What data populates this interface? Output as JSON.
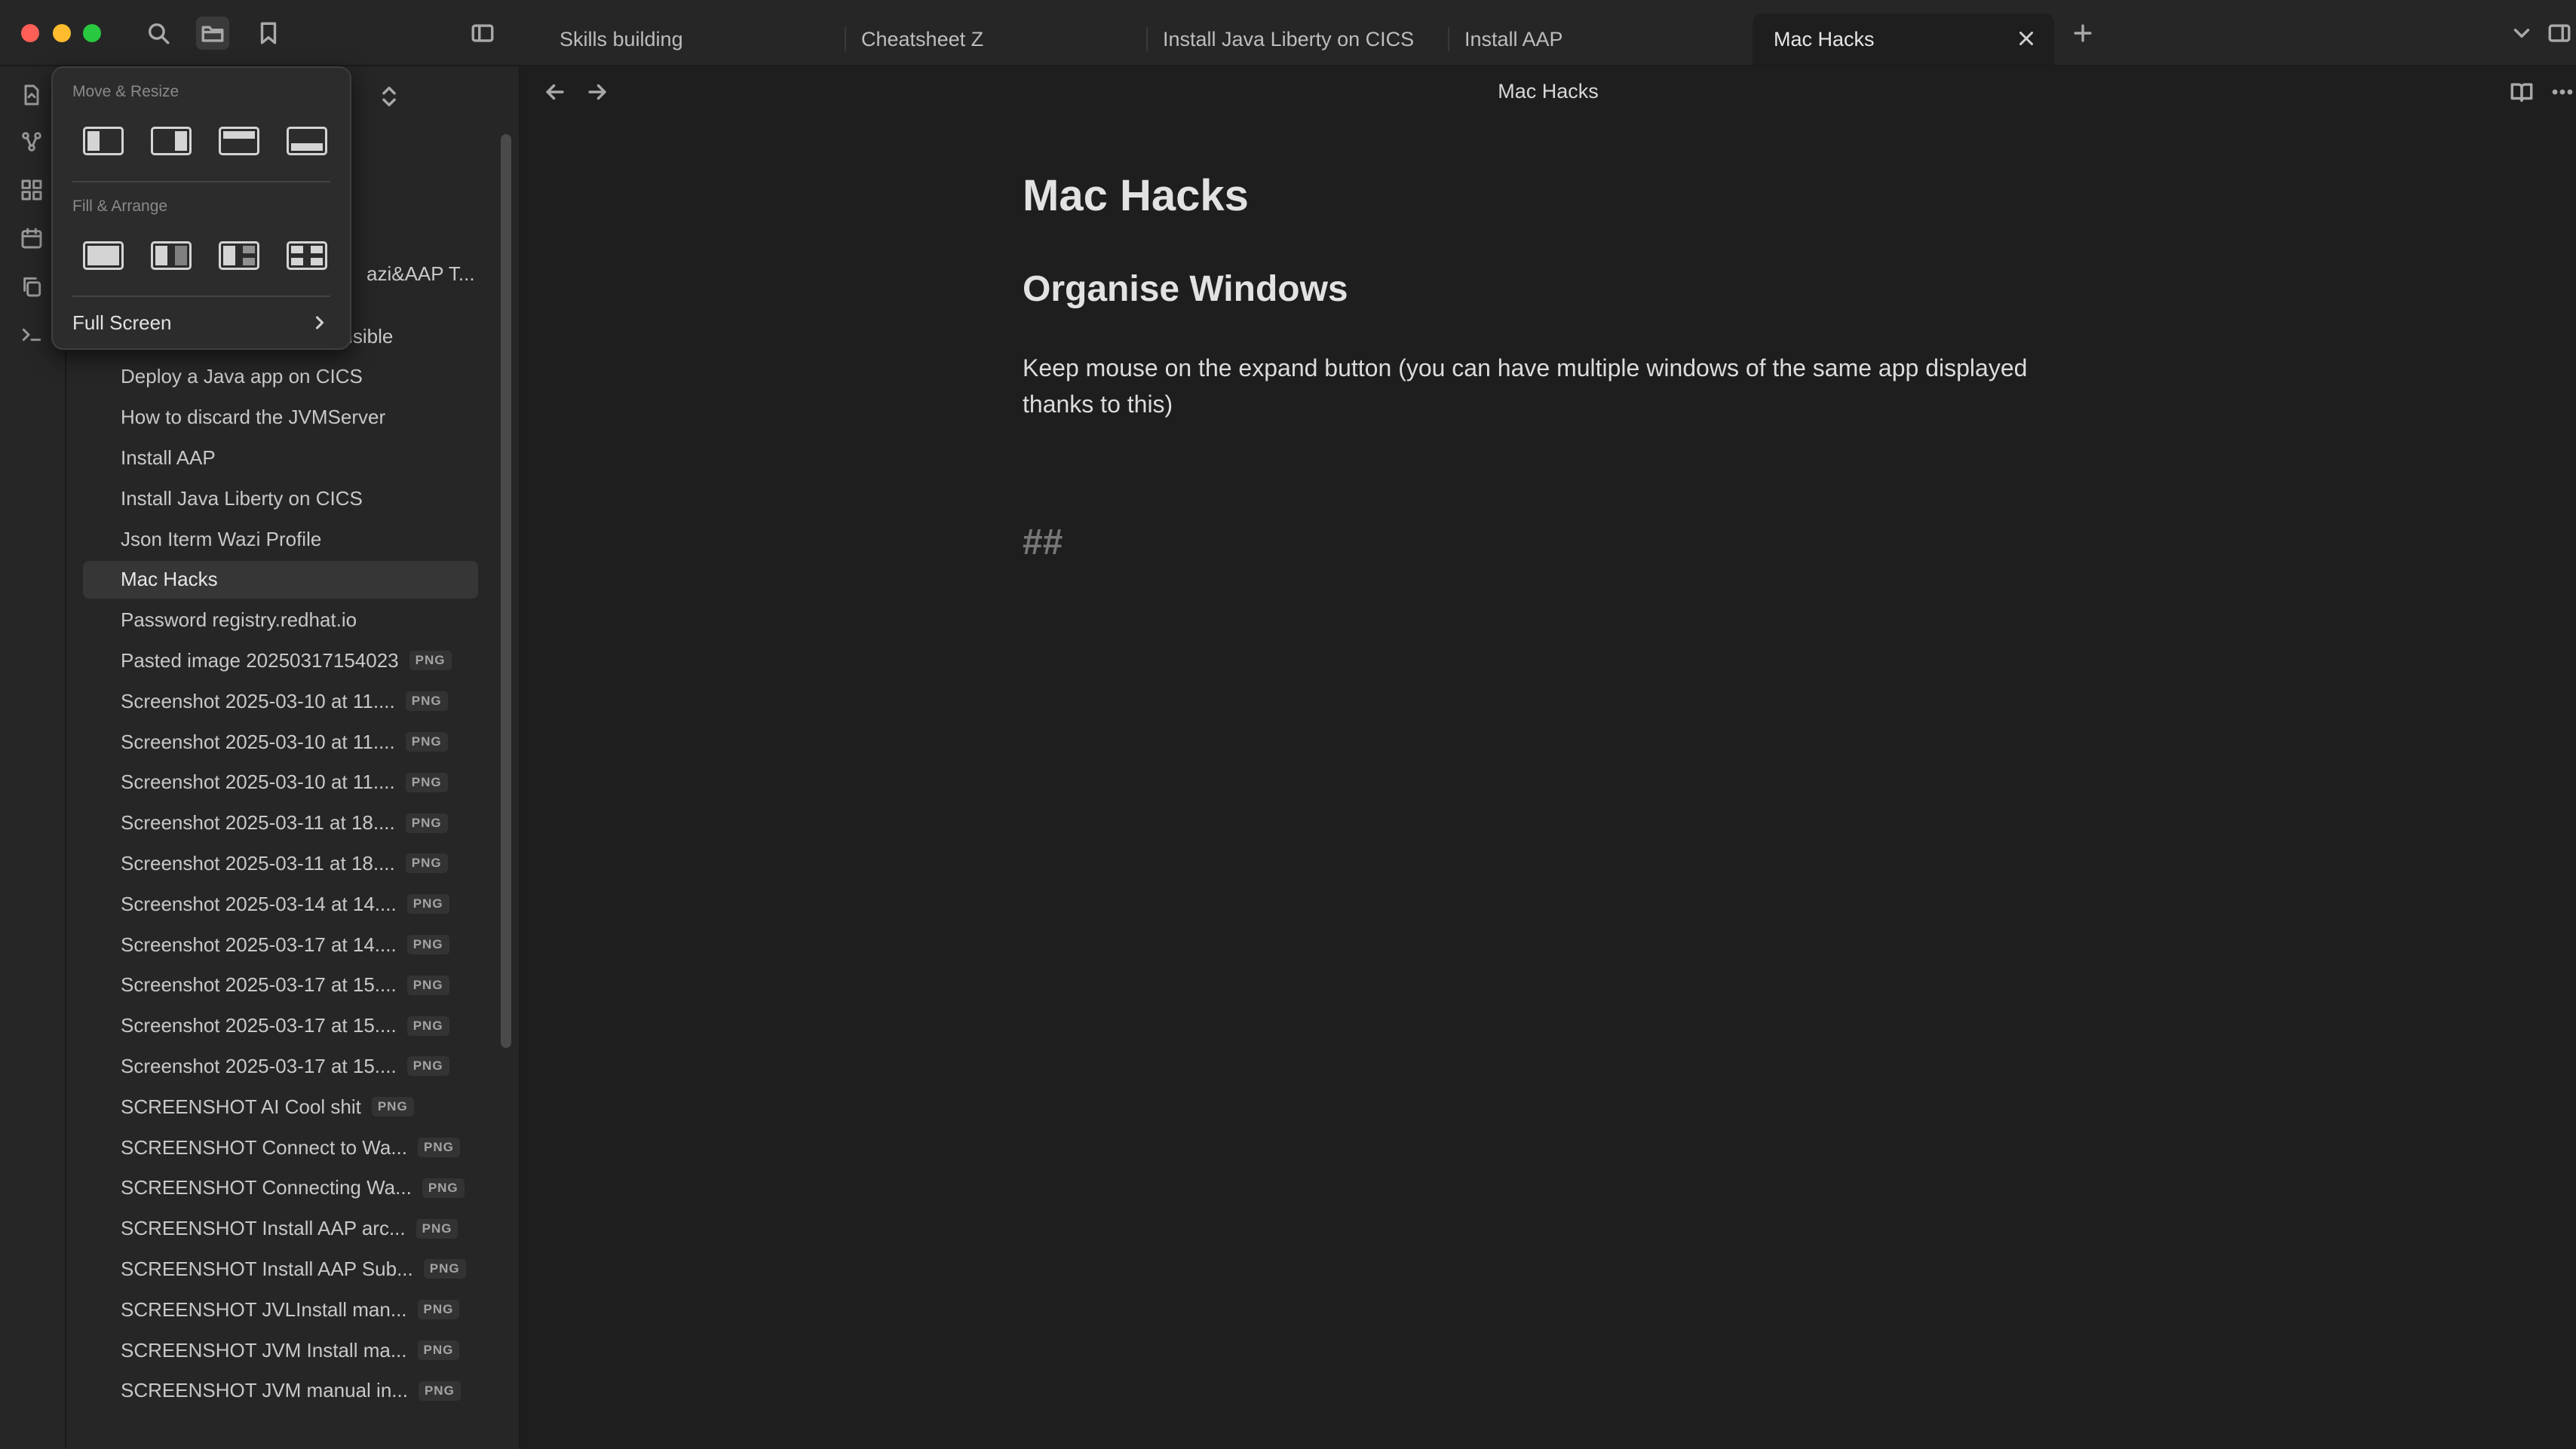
{
  "tabs": [
    {
      "label": "Skills building"
    },
    {
      "label": "Cheatsheet Z"
    },
    {
      "label": "Install Java Liberty on CICS"
    },
    {
      "label": "Install AAP"
    },
    {
      "label": "Mac Hacks"
    }
  ],
  "popup": {
    "move_resize_title": "Move & Resize",
    "fill_arrange_title": "Fill & Arrange",
    "full_screen_label": "Full Screen"
  },
  "sidebar": {
    "partial_item": "azi&AAP T...",
    "files": [
      {
        "name": "Debugging the job from Ansible",
        "badge": ""
      },
      {
        "name": "Deploy a Java app on CICS",
        "badge": ""
      },
      {
        "name": "How to discard the JVMServer",
        "badge": ""
      },
      {
        "name": "Install AAP",
        "badge": ""
      },
      {
        "name": "Install Java Liberty on CICS",
        "badge": ""
      },
      {
        "name": "Json Iterm Wazi Profile",
        "badge": ""
      },
      {
        "name": "Mac Hacks",
        "badge": ""
      },
      {
        "name": "Password registry.redhat.io",
        "badge": ""
      },
      {
        "name": "Pasted image 20250317154023",
        "badge": "PNG"
      },
      {
        "name": "Screenshot 2025-03-10 at 11....",
        "badge": "PNG"
      },
      {
        "name": "Screenshot 2025-03-10 at 11....",
        "badge": "PNG"
      },
      {
        "name": "Screenshot 2025-03-10 at 11....",
        "badge": "PNG"
      },
      {
        "name": "Screenshot 2025-03-11 at 18....",
        "badge": "PNG"
      },
      {
        "name": "Screenshot 2025-03-11 at 18....",
        "badge": "PNG"
      },
      {
        "name": "Screenshot 2025-03-14 at 14....",
        "badge": "PNG"
      },
      {
        "name": "Screenshot 2025-03-17 at 14....",
        "badge": "PNG"
      },
      {
        "name": "Screenshot 2025-03-17 at 15....",
        "badge": "PNG"
      },
      {
        "name": "Screenshot 2025-03-17 at 15....",
        "badge": "PNG"
      },
      {
        "name": "Screenshot 2025-03-17 at 15....",
        "badge": "PNG"
      },
      {
        "name": "SCREENSHOT AI Cool shit",
        "badge": "PNG"
      },
      {
        "name": "SCREENSHOT Connect to Wa...",
        "badge": "PNG"
      },
      {
        "name": "SCREENSHOT Connecting Wa...",
        "badge": "PNG"
      },
      {
        "name": "SCREENSHOT Install AAP arc...",
        "badge": "PNG"
      },
      {
        "name": "SCREENSHOT Install AAP Sub...",
        "badge": "PNG"
      },
      {
        "name": "SCREENSHOT JVLInstall man...",
        "badge": "PNG"
      },
      {
        "name": "SCREENSHOT JVM Install ma...",
        "badge": "PNG"
      },
      {
        "name": "SCREENSHOT JVM manual in...",
        "badge": "PNG"
      }
    ]
  },
  "editor": {
    "header_title": "Mac Hacks",
    "h1": "Mac Hacks",
    "h2": "Organise Windows",
    "paragraph": "Keep mouse on the expand button (you can have multiple windows of the same app displayed thanks to this)",
    "hash_line": "##"
  }
}
